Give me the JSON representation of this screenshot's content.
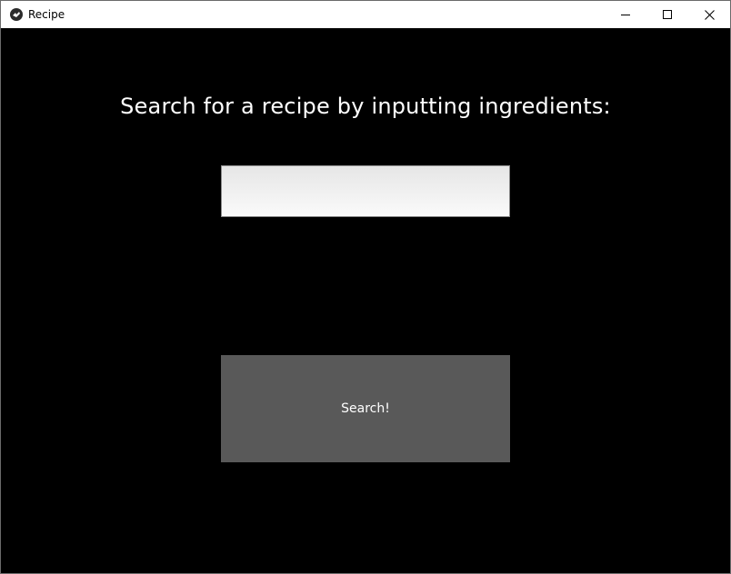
{
  "window": {
    "title": "Recipe",
    "app_icon": "kivy-logo-icon",
    "controls": [
      "minimize-icon",
      "maximize-icon",
      "close-icon"
    ]
  },
  "main": {
    "heading": "Search for a recipe by inputting ingredients:",
    "ingredients_input": {
      "value": "",
      "placeholder": ""
    },
    "search_button_label": "Search!"
  },
  "colors": {
    "background": "#000000",
    "titlebar": "#ffffff",
    "button": "#595959",
    "text": "#ffffff"
  }
}
